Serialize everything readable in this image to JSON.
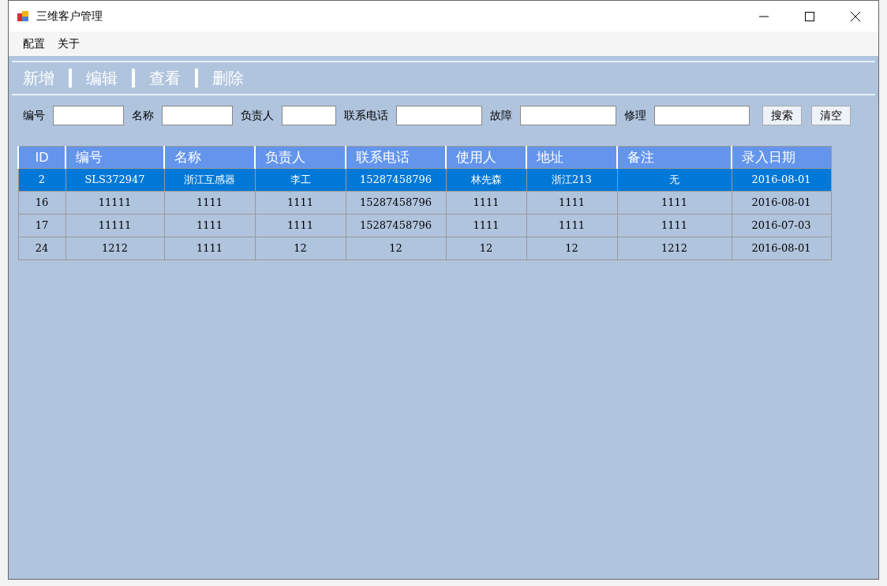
{
  "window": {
    "title": "三维客户管理"
  },
  "menu": [
    "配置",
    "关于"
  ],
  "toolbar": [
    "新增",
    "编辑",
    "查看",
    "删除"
  ],
  "search": {
    "fields": [
      {
        "label": "编号"
      },
      {
        "label": "名称"
      },
      {
        "label": "负责人"
      },
      {
        "label": "联系电话"
      },
      {
        "label": "故障"
      },
      {
        "label": "修理"
      }
    ],
    "buttons": [
      "搜索",
      "清空"
    ]
  },
  "table": {
    "columns": [
      "ID",
      "编号",
      "名称",
      "负责人",
      "联系电话",
      "使用人",
      "地址",
      "备注",
      "录入日期"
    ],
    "rows": [
      {
        "selected": true,
        "cells": [
          "2",
          "SLS372947",
          "浙江互感器",
          "李工",
          "15287458796",
          "林先森",
          "浙江213",
          "无",
          "2016-08-01"
        ]
      },
      {
        "selected": false,
        "cells": [
          "16",
          "11111",
          "1111",
          "1111",
          "15287458796",
          "1111",
          "1111",
          "1111",
          "2016-08-01"
        ]
      },
      {
        "selected": false,
        "cells": [
          "17",
          "11111",
          "1111",
          "1111",
          "15287458796",
          "1111",
          "1111",
          "1111",
          "2016-07-03"
        ]
      },
      {
        "selected": false,
        "cells": [
          "24",
          "1212",
          "1111",
          "12",
          "12",
          "12",
          "12",
          "1212",
          "2016-08-01"
        ]
      }
    ]
  }
}
